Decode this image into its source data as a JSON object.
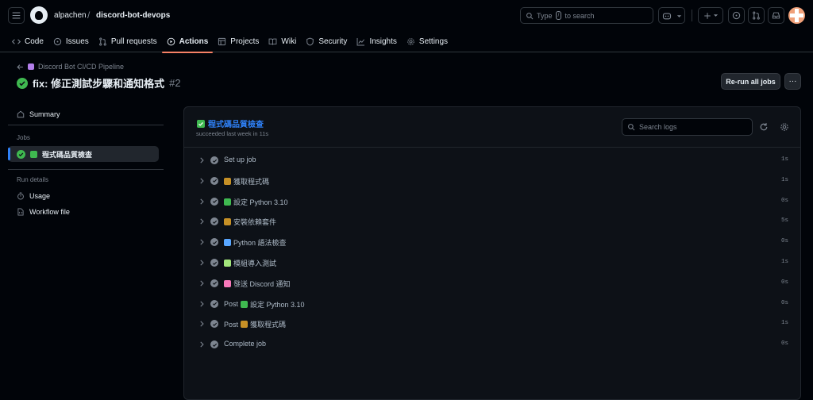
{
  "header": {
    "owner": "alpachen",
    "separator": "/",
    "repo": "discord-bot-devops",
    "search": {
      "pre": "Type",
      "key": "/",
      "post": "to search"
    }
  },
  "tabs": [
    {
      "label": "Code",
      "icon": "code-icon"
    },
    {
      "label": "Issues",
      "icon": "issue-icon"
    },
    {
      "label": "Pull requests",
      "icon": "pull-request-icon"
    },
    {
      "label": "Actions",
      "icon": "play-icon",
      "active": true
    },
    {
      "label": "Projects",
      "icon": "table-icon"
    },
    {
      "label": "Wiki",
      "icon": "book-icon"
    },
    {
      "label": "Security",
      "icon": "shield-icon"
    },
    {
      "label": "Insights",
      "icon": "graph-icon"
    },
    {
      "label": "Settings",
      "icon": "gear-icon"
    }
  ],
  "run": {
    "workflow_name": "Discord Bot CI/CD Pipeline",
    "title": "fix: 修正測試步驟和通知格式",
    "number": "#2",
    "rerun_label": "Re-run all jobs",
    "more_label": "···"
  },
  "sidebar": {
    "summary": "Summary",
    "jobs_heading": "Jobs",
    "job_label": "程式碼品質檢查",
    "run_details_heading": "Run details",
    "usage": "Usage",
    "workflow_file": "Workflow file"
  },
  "job": {
    "title": "程式碼品質檢查",
    "subtitle": "succeeded last week in 11s",
    "search_placeholder": "Search logs",
    "steps": [
      {
        "prefix": "",
        "emoji": "",
        "name": "Set up job",
        "duration": "1s"
      },
      {
        "prefix": "",
        "emoji": "package",
        "name": "獲取程式碼",
        "duration": "1s"
      },
      {
        "prefix": "",
        "emoji": "snake",
        "name": "設定 Python 3.10",
        "duration": "0s"
      },
      {
        "prefix": "",
        "emoji": "package",
        "name": "安裝依賴套件",
        "duration": "5s"
      },
      {
        "prefix": "",
        "emoji": "magnifier",
        "name": "Python 語法檢查",
        "duration": "0s"
      },
      {
        "prefix": "",
        "emoji": "test-tube",
        "name": "模組導入測試",
        "duration": "1s"
      },
      {
        "prefix": "",
        "emoji": "megaphone",
        "name": "發送 Discord 通知",
        "duration": "0s"
      },
      {
        "prefix": "Post",
        "emoji": "snake",
        "name": "設定 Python 3.10",
        "duration": "0s"
      },
      {
        "prefix": "Post",
        "emoji": "package",
        "name": "獲取程式碼",
        "duration": "1s"
      },
      {
        "prefix": "",
        "emoji": "",
        "name": "Complete job",
        "duration": "0s"
      }
    ]
  },
  "colors": {
    "success": "#3fb950",
    "accent": "#2f81f7",
    "tab_underline": "#f78166",
    "step_check": "#7d8590"
  }
}
